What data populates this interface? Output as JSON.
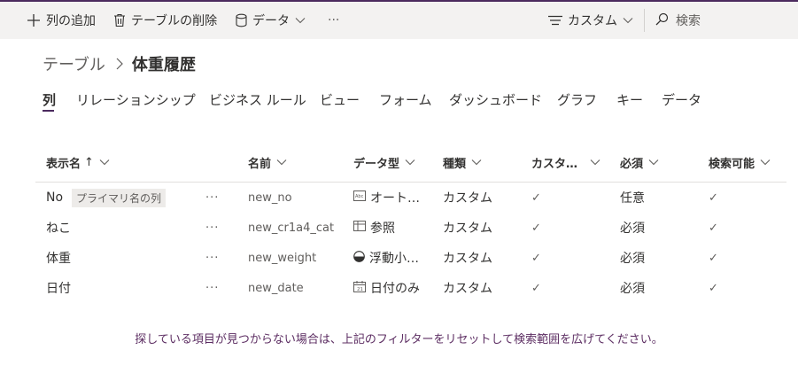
{
  "toolbar": {
    "add_column": "列の追加",
    "delete_table": "テーブルの削除",
    "data_menu": "データ",
    "more": "···",
    "view": "カスタム",
    "search_placeholder": "検索"
  },
  "breadcrumb": {
    "parent": "テーブル",
    "current": "体重履歴"
  },
  "tabs": [
    {
      "label": "列",
      "active": true
    },
    {
      "label": "リレーションシップ"
    },
    {
      "label": "ビジネス ルール"
    },
    {
      "label": "ビュー"
    },
    {
      "label": "フォーム"
    },
    {
      "label": "ダッシュボード"
    },
    {
      "label": "グラフ"
    },
    {
      "label": "キー"
    },
    {
      "label": "データ"
    }
  ],
  "columns": {
    "display_name": "表示名",
    "sort_indicator": "↑",
    "name": "名前",
    "data_type": "データ型",
    "type": "種類",
    "customizable": "カスタ…",
    "required": "必須",
    "searchable": "検索可能"
  },
  "rows": [
    {
      "display_name": "No",
      "badge": "プライマリ名の列",
      "menu": "···",
      "name": "new_no",
      "data_type": "オート…",
      "data_type_icon": "autonumber-icon",
      "type": "カスタム",
      "customizable": "✓",
      "required": "任意",
      "searchable": "✓"
    },
    {
      "display_name": "ねこ",
      "menu": "···",
      "name": "new_cr1a4_cat",
      "data_type": "参照",
      "data_type_icon": "lookup-icon",
      "type": "カスタム",
      "customizable": "✓",
      "required": "必須",
      "searchable": "✓"
    },
    {
      "display_name": "体重",
      "menu": "···",
      "name": "new_weight",
      "data_type": "浮動小…",
      "data_type_icon": "float-icon",
      "type": "カスタム",
      "customizable": "✓",
      "required": "必須",
      "searchable": "✓"
    },
    {
      "display_name": "日付",
      "menu": "···",
      "name": "new_date",
      "data_type": "日付のみ",
      "data_type_icon": "calendar-icon",
      "type": "カスタム",
      "customizable": "✓",
      "required": "必須",
      "searchable": "✓"
    }
  ],
  "empty_note": "探している項目が見つからない場合は、上記のフィルターをリセットして検索範囲を広げてください。",
  "colors": {
    "accent": "#4b2a5e",
    "note": "#5c2d62",
    "toolbar_bg": "#f3f2f1"
  }
}
